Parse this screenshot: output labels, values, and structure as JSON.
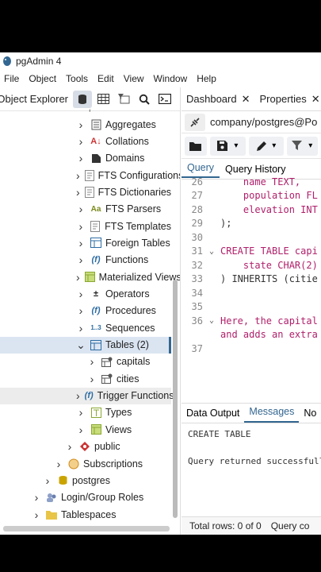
{
  "window": {
    "title": "pgAdmin 4"
  },
  "menu": [
    "File",
    "Object",
    "Tools",
    "Edit",
    "View",
    "Window",
    "Help"
  ],
  "object_explorer": {
    "title": "Object Explorer",
    "tree": [
      {
        "label": "Aggregates"
      },
      {
        "label": "Collations"
      },
      {
        "label": "Domains"
      },
      {
        "label": "FTS Configurations"
      },
      {
        "label": "FTS Dictionaries"
      },
      {
        "label": "FTS Parsers"
      },
      {
        "label": "FTS Templates"
      },
      {
        "label": "Foreign Tables"
      },
      {
        "label": "Functions"
      },
      {
        "label": "Materialized Views"
      },
      {
        "label": "Operators"
      },
      {
        "label": "Procedures"
      },
      {
        "label": "Sequences"
      },
      {
        "label": "Tables (2)"
      },
      {
        "label": "capitals"
      },
      {
        "label": "cities"
      },
      {
        "label": "Trigger Functions"
      },
      {
        "label": "Types"
      },
      {
        "label": "Views"
      },
      {
        "label": "public"
      },
      {
        "label": "Subscriptions"
      },
      {
        "label": "postgres"
      },
      {
        "label": "Login/Group Roles"
      },
      {
        "label": "Tablespaces"
      }
    ]
  },
  "tabs": [
    {
      "label": "Dashboard"
    },
    {
      "label": "Properties"
    }
  ],
  "connection": {
    "label": "company/postgres@Po"
  },
  "query_tabs": {
    "query": "Query",
    "history": "Query History"
  },
  "editor": {
    "lines": [
      {
        "n": "26",
        "code": "    name TEXT,"
      },
      {
        "n": "27",
        "code": "    population FL"
      },
      {
        "n": "28",
        "code": "    elevation INT"
      },
      {
        "n": "29",
        "code": ");"
      },
      {
        "n": "30",
        "code": ""
      },
      {
        "n": "31",
        "code": "CREATE TABLE capi"
      },
      {
        "n": "32",
        "code": "    state CHAR(2)"
      },
      {
        "n": "33",
        "code": ") INHERITS (citie"
      },
      {
        "n": "34",
        "code": ""
      },
      {
        "n": "35",
        "code": ""
      },
      {
        "n": "36",
        "code": "Here, the capital"
      },
      {
        "n": "",
        "code": "and adds an extra"
      },
      {
        "n": "37",
        "code": ""
      }
    ]
  },
  "output_tabs": {
    "data": "Data Output",
    "messages": "Messages",
    "notifications": "No"
  },
  "output": {
    "line1": "CREATE TABLE",
    "line2": "Query returned successfully"
  },
  "status": {
    "rows": "Total rows: 0 of 0",
    "query": "Query co"
  },
  "colors": {
    "accent": "#326690",
    "keyword": "#b0206b"
  }
}
